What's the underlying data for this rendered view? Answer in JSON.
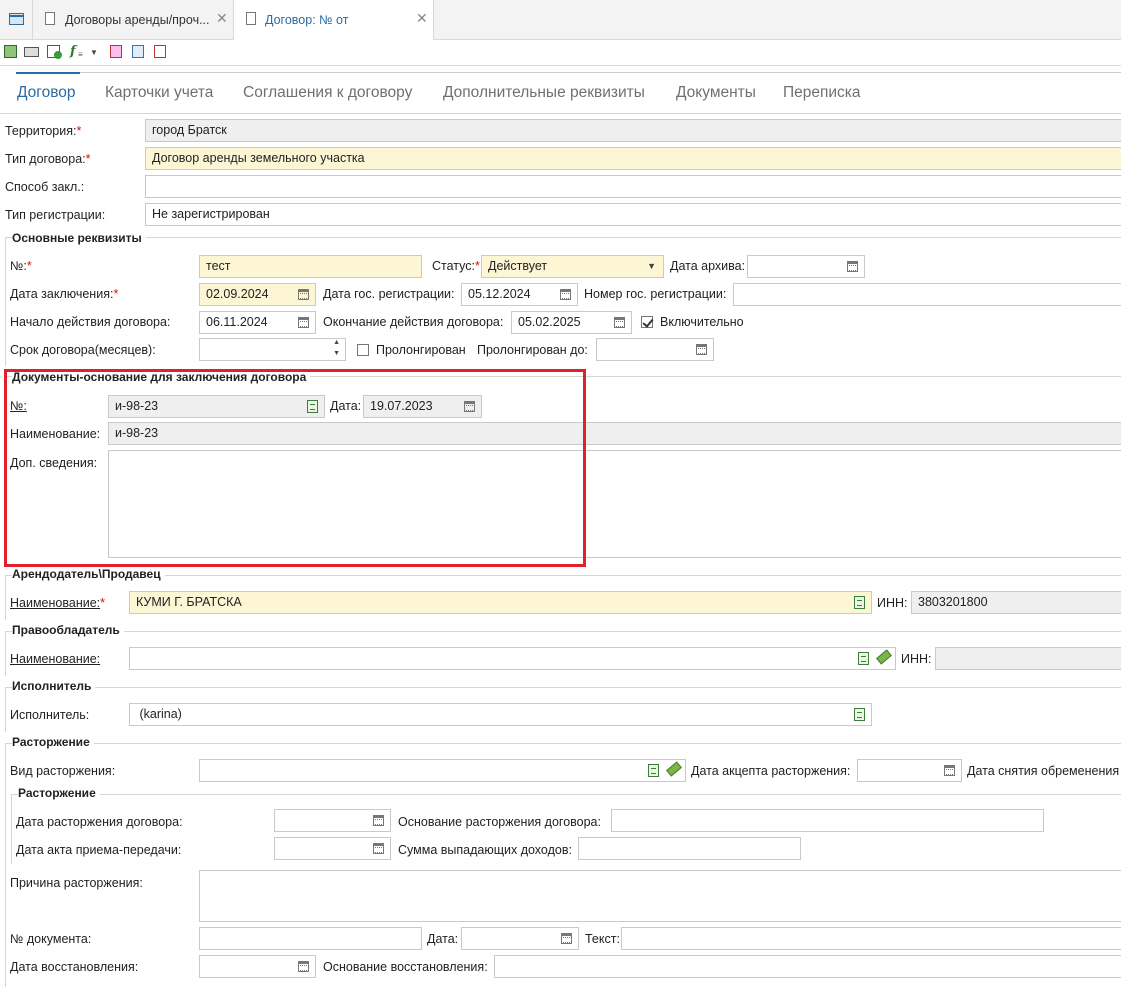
{
  "tabs": {
    "tab1": "Договоры аренды/проч...",
    "tab2": "Договор: № от"
  },
  "nav_tabs": [
    "Договор",
    "Карточки учета",
    "Соглашения к договору",
    "Дополнительные реквизиты",
    "Документы",
    "Переписка"
  ],
  "general": {
    "territory_label": "Территория:",
    "territory_value": "город Братск",
    "contract_type_label": "Тип договора:",
    "contract_type_value": "Договор аренды земельного участка",
    "method_label": "Способ закл.:",
    "method_value": "",
    "reg_type_label": "Тип регистрации:",
    "reg_type_value": "Не зарегистрирован"
  },
  "main_details": {
    "title": "Основные реквизиты",
    "number_label": "№:",
    "number_value": "тест",
    "status_label": "Статус:",
    "status_value": "Действует",
    "archive_date_label": "Дата архива:",
    "archive_date_value": "",
    "conclusion_date_label": "Дата заключения:",
    "conclusion_date_value": "02.09.2024",
    "state_reg_date_label": "Дата гос. регистрации:",
    "state_reg_date_value": "05.12.2024",
    "state_reg_number_label": "Номер гос. регистрации:",
    "state_reg_number_value": "",
    "start_label": "Начало действия договора:",
    "start_value": "06.11.2024",
    "end_label": "Окончание действия договора:",
    "end_value": "05.02.2025",
    "inclusive_label": "Включительно",
    "inclusive_checked": true,
    "term_label": "Срок договора(месяцев):",
    "term_value": "",
    "prolonged_label": "Пролонгирован",
    "prolonged_checked": false,
    "prolonged_until_label": "Пролонгирован до:",
    "prolonged_until_value": ""
  },
  "basis_docs": {
    "title": "Документы-основание для заключения договора",
    "number_label": "№:",
    "number_value": "и-98-23",
    "date_label": "Дата:",
    "date_value": "19.07.2023",
    "name_label": "Наименование:",
    "name_value": "и-98-23",
    "extra_label": "Доп. сведения:",
    "extra_value": "",
    "highlight_color": "#e0202a"
  },
  "lessor": {
    "title": "Арендодатель\\Продавец",
    "name_label": "Наименование:",
    "name_value": "КУМИ Г. БРАТСКА",
    "inn_label": "ИНН:",
    "inn_value": "3803201800"
  },
  "owner": {
    "title": "Правообладатель",
    "name_label": "Наименование:",
    "name_value": "",
    "inn_label": "ИНН:",
    "inn_value": ""
  },
  "executor": {
    "title": "Исполнитель",
    "label": "Исполнитель:",
    "value": " (karina)"
  },
  "termination": {
    "title": "Расторжение",
    "kind_label": "Вид расторжения:",
    "kind_value": "",
    "accept_date_label": "Дата акцепта расторжения:",
    "accept_date_value": "",
    "encumbrance_label": "Дата снятия обременения",
    "sub_title": "Расторжение",
    "term_date_label": "Дата расторжения договора:",
    "term_date_value": "",
    "basis_label": "Основание расторжения договора:",
    "basis_value": "",
    "act_date_label": "Дата акта приема-передачи:",
    "act_date_value": "",
    "lost_income_label": "Сумма выпадающих доходов:",
    "lost_income_value": "",
    "reason_label": "Причина расторжения:",
    "reason_value": "",
    "doc_number_label": "№ документа:",
    "doc_number_value": "",
    "doc_date_label": "Дата:",
    "doc_date_value": "",
    "text_label": "Текст:",
    "text_value": "",
    "restore_date_label": "Дата восстановления:",
    "restore_date_value": "",
    "restore_basis_label": "Основание восстановления:",
    "restore_basis_value": ""
  }
}
